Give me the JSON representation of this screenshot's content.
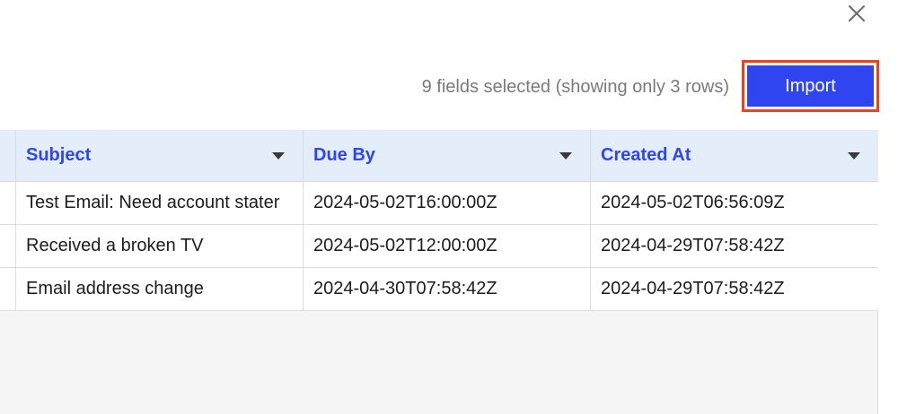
{
  "dialog": {
    "close_icon": "close-icon"
  },
  "toolbar": {
    "summary": "9 fields selected (showing only 3 rows)",
    "import_label": "Import",
    "import_color": "#2f45f0",
    "import_highlight_color": "#e8431d"
  },
  "table": {
    "header_color": "#2f45f0",
    "header_background": "#e4eefb",
    "columns": [
      {
        "label": "Subject",
        "icon": "chevron-down-icon"
      },
      {
        "label": "Due By",
        "icon": "chevron-down-icon"
      },
      {
        "label": "Created At",
        "icon": "chevron-down-icon"
      }
    ],
    "rows": [
      [
        "Test Email: Need account stater",
        "2024-05-02T16:00:00Z",
        "2024-05-02T06:56:09Z"
      ],
      [
        "Received a broken TV",
        "2024-05-02T12:00:00Z",
        "2024-04-29T07:58:42Z"
      ],
      [
        "Email address change",
        "2024-04-30T07:58:42Z",
        "2024-04-29T07:58:42Z"
      ]
    ]
  }
}
